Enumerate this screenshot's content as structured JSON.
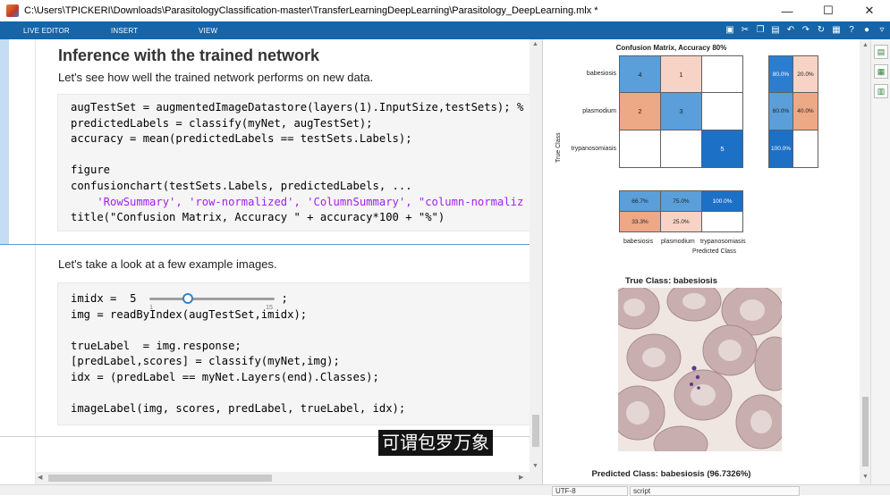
{
  "window": {
    "title": "C:\\Users\\TPICKERI\\Downloads\\ParasitologyClassification-master\\TransferLearningDeepLearning\\Parasitology_DeepLearning.mlx *"
  },
  "ribbon": {
    "tabs": [
      "LIVE EDITOR",
      "INSERT",
      "VIEW"
    ]
  },
  "editor": {
    "heading": "Inference with the trained network",
    "intro": "Let's see how well the trained network performs on new data.",
    "code1": [
      "augTestSet = augmentedImageDatastore(layers(1).InputSize,testSets); %",
      "predictedLabels = classify(myNet, augTestSet);",
      "accuracy = mean(predictedLabels == testSets.Labels);",
      "",
      "figure",
      "confusionchart(testSets.Labels, predictedLabels, ...",
      "    'RowSummary', 'row-normalized', 'ColumnSummary', \"column-normaliz",
      "title(\"Confusion Matrix, Accuracy \" + accuracy*100 + \"%\")"
    ],
    "examples_text": "Let's take a look at a few example images.",
    "slider": {
      "var": "imidx =",
      "value": "5",
      "min": "1",
      "max": "15",
      "fraction": 0.2857,
      "suffix": ";"
    },
    "code2": [
      "img = readByIndex(augTestSet,imidx);",
      "",
      "trueLabel  = img.response;",
      "[predLabel,scores] = classify(myNet,img);",
      "idx = (predLabel == myNet.Layers(end).Classes);",
      "",
      "imageLabel(img, scores, predLabel, trueLabel, idx);"
    ]
  },
  "output": {
    "cm_title": "Confusion Matrix, Accuracy 80%",
    "true_class_axis": "True Class",
    "predicted_class_axis": "Predicted Class",
    "classes": [
      "babesiosis",
      "plasmodium",
      "trypanosomiasis"
    ],
    "matrix": [
      [
        "4",
        "1",
        ""
      ],
      [
        "2",
        "3",
        ""
      ],
      [
        "",
        "",
        "5"
      ]
    ],
    "row_summary": [
      [
        "80.0%",
        "20.0%"
      ],
      [
        "60.0%",
        "40.0%"
      ],
      [
        "100.0%",
        ""
      ]
    ],
    "col_summary": [
      [
        "66.7%",
        "75.0%",
        "100.0%"
      ],
      [
        "33.3%",
        "25.0%",
        ""
      ]
    ],
    "image_title": "True Class: babesiosis",
    "predicted_title": "Predicted Class: babesiosis (96.7326%)"
  },
  "subtitle": "可谓包罗万象",
  "status": {
    "encoding": "UTF-8",
    "mode": "script"
  },
  "colors": {
    "ribbon": "#1565a8",
    "cm_dark_blue": "#1c70c6",
    "cm_mid_blue": "#5a9fd9",
    "cm_light_orange": "#f7d3c5",
    "cm_orange": "#eda886"
  }
}
